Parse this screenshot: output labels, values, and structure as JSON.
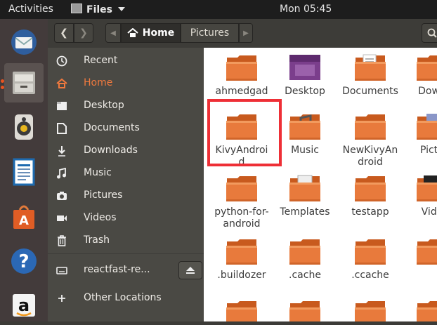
{
  "topbar": {
    "activities": "Activities",
    "app_name": "Files",
    "clock": "Mon 05:45"
  },
  "dock": {
    "items": [
      {
        "name": "thunderbird-mail",
        "active": false
      },
      {
        "name": "files",
        "active": true
      },
      {
        "name": "rhythmbox",
        "active": false
      },
      {
        "name": "libreoffice-writer",
        "active": false
      },
      {
        "name": "ubuntu-software",
        "active": false
      },
      {
        "name": "help",
        "active": false
      },
      {
        "name": "amazon",
        "active": false
      }
    ]
  },
  "header": {
    "path": [
      "Home",
      "Pictures"
    ]
  },
  "sidebar": {
    "items": [
      {
        "label": "Recent",
        "icon": "clock-icon",
        "active": false
      },
      {
        "label": "Home",
        "icon": "home-icon",
        "active": true
      },
      {
        "label": "Desktop",
        "icon": "folder-icon",
        "active": false
      },
      {
        "label": "Documents",
        "icon": "document-icon",
        "active": false
      },
      {
        "label": "Downloads",
        "icon": "download-icon",
        "active": false
      },
      {
        "label": "Music",
        "icon": "music-icon",
        "active": false
      },
      {
        "label": "Pictures",
        "icon": "camera-icon",
        "active": false
      },
      {
        "label": "Videos",
        "icon": "video-icon",
        "active": false
      },
      {
        "label": "Trash",
        "icon": "trash-icon",
        "active": false
      },
      {
        "label": "reactfast-re...",
        "icon": "drive-icon",
        "active": false
      },
      {
        "label": "Other Locations",
        "icon": "plus-icon",
        "active": false
      }
    ]
  },
  "files": [
    {
      "name": "ahmedgad",
      "kind": "folder"
    },
    {
      "name": "Desktop",
      "kind": "desktop"
    },
    {
      "name": "Documents",
      "kind": "documents"
    },
    {
      "name": "Down",
      "kind": "folder"
    },
    {
      "name": "KivyAndroid",
      "kind": "folder",
      "selected": true
    },
    {
      "name": "Music",
      "kind": "music"
    },
    {
      "name": "NewKivyAndroid",
      "kind": "folder"
    },
    {
      "name": "Pictu",
      "kind": "pictures"
    },
    {
      "name": "python-for-android",
      "kind": "folder"
    },
    {
      "name": "Templates",
      "kind": "templates"
    },
    {
      "name": "testapp",
      "kind": "folder"
    },
    {
      "name": "Vide",
      "kind": "videos"
    },
    {
      "name": ".buildozer",
      "kind": "folder"
    },
    {
      "name": ".cache",
      "kind": "folder"
    },
    {
      "name": ".ccache",
      "kind": "folder"
    },
    {
      "name": "",
      "kind": "folder"
    },
    {
      "name": "",
      "kind": "folder"
    },
    {
      "name": "",
      "kind": "folder"
    },
    {
      "name": "",
      "kind": "folder"
    },
    {
      "name": "",
      "kind": "folder"
    }
  ],
  "files_display": [
    "ahmedgad",
    "Desktop",
    "Documents",
    "Down",
    "KivyAndroi\nd",
    "Music",
    "NewKivyAn\ndroid",
    "Pictu",
    "python-for-\nandroid",
    "Templates",
    "testapp",
    "Vide",
    ".buildozer",
    ".cache",
    ".ccache",
    "",
    "",
    "",
    "",
    ""
  ],
  "colors": {
    "accent": "#e95420",
    "highlight_box": "#ee2f36",
    "folder": "#e87a3c"
  }
}
